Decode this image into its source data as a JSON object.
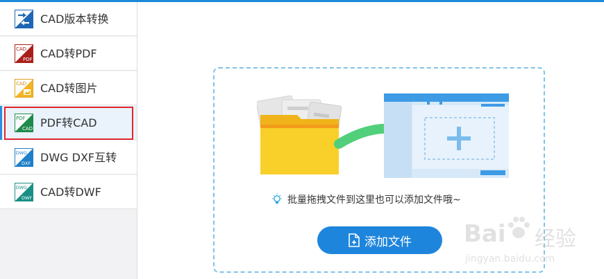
{
  "sidebar": {
    "items": [
      {
        "label": "CAD版本转换",
        "icon": "cad-version-convert-icon",
        "active": false
      },
      {
        "label": "CAD转PDF",
        "icon": "cad-to-pdf-icon",
        "active": false
      },
      {
        "label": "CAD转图片",
        "icon": "cad-to-image-icon",
        "active": false
      },
      {
        "label": "PDF转CAD",
        "icon": "pdf-to-cad-icon",
        "active": true
      },
      {
        "label": "DWG DXF互转",
        "icon": "dwg-dxf-convert-icon",
        "active": false
      },
      {
        "label": "CAD转DWF",
        "icon": "cad-to-dwf-icon",
        "active": false
      }
    ],
    "icon_texts": {
      "cad": "CAD",
      "pdf": "PDF",
      "dwg": "DWG",
      "dxf": "DXF",
      "dwf": "DWF"
    }
  },
  "dropzone": {
    "hint": "批量拖拽文件到这里也可以添加文件哦~",
    "add_button_label": "添加文件",
    "hint_icon": "lightbulb-icon",
    "button_icon": "add-file-icon"
  },
  "watermark": {
    "brand": "Bai",
    "brand_cn": "经验",
    "url": "jingyan.baidu.com"
  },
  "colors": {
    "accent": "#1e85dc",
    "highlight_border": "#e0262d",
    "dropzone_border": "#7fc3e8",
    "folder": "#f5c518",
    "arrow": "#4fcf7a"
  }
}
